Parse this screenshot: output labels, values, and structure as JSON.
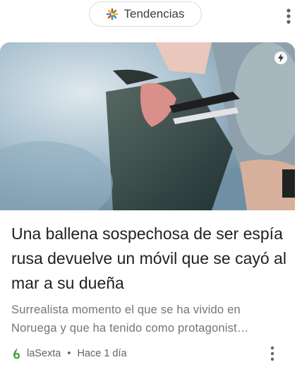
{
  "topbar": {
    "chip_label": "Tendencias",
    "chip_icon": "google-asterisk-icon",
    "more_icon": "more-vert-icon"
  },
  "article": {
    "image_description_icon": "amp-lightning-icon",
    "title": "Una ballena sospechosa de ser espía rusa devuelve un móvil que se cayó al mar a su dueña",
    "snippet_line1": "Surrealista momento el que se ha vivido en",
    "snippet_line2": "Noruega y que ha tenido como protagonist…",
    "source": "laSexta",
    "separator": "•",
    "time": "Hace 1 día",
    "source_logo_icon": "lasexta-logo-icon",
    "more_icon": "more-vert-icon"
  },
  "colors": {
    "title": "#202124",
    "snippet": "#70757a",
    "meta": "#5f6368",
    "chip_border": "#dadce0",
    "source_logo_green": "#3fa535"
  }
}
